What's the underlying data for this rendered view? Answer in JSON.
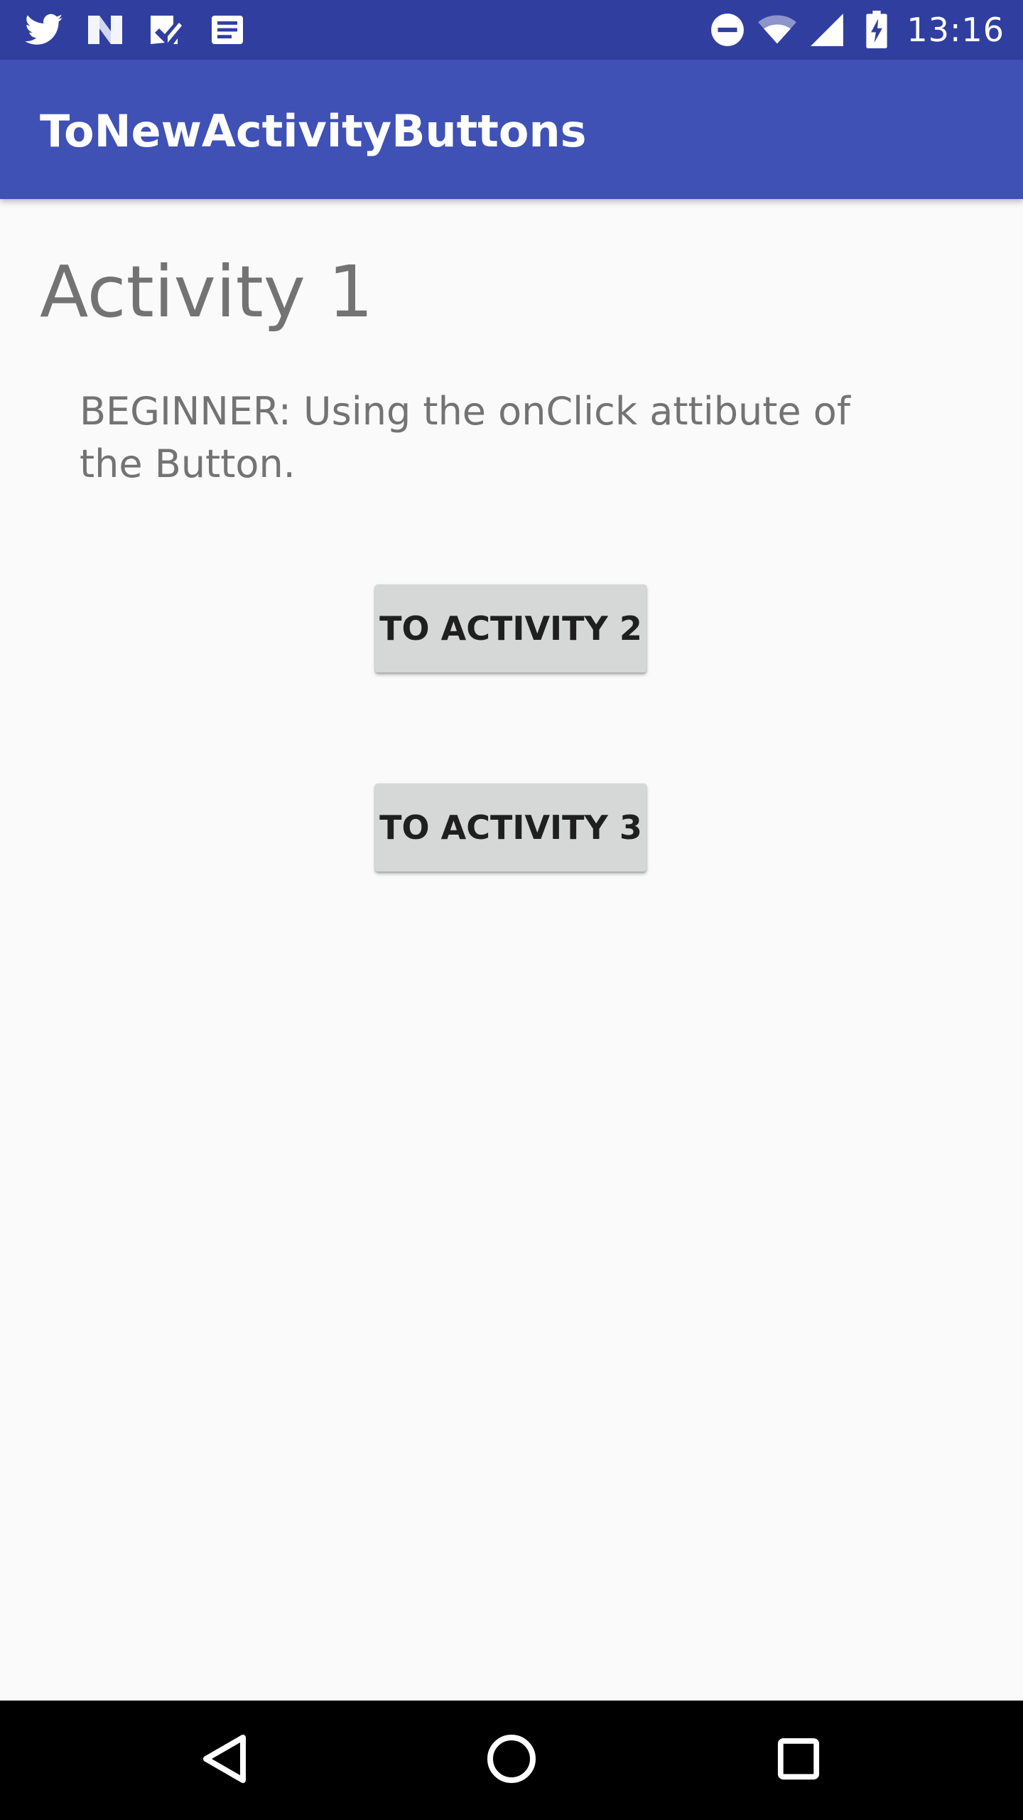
{
  "status_bar": {
    "time": "13:16",
    "background": "#303F9F",
    "left_icons": [
      "twitter-icon",
      "news-icon",
      "checklist-icon",
      "message-icon"
    ],
    "right_icons": [
      "do-not-disturb-icon",
      "wifi-icon",
      "cellular-signal-icon",
      "battery-charging-icon"
    ]
  },
  "app_bar": {
    "title": "ToNewActivityButtons",
    "background": "#3F51B5"
  },
  "content": {
    "heading": "Activity 1",
    "description": "BEGINNER: Using the onClick attibute of the Button.",
    "text_color": "#737373"
  },
  "buttons": {
    "activity2_label": "TO ACTIVITY 2",
    "activity3_label": "TO ACTIVITY 3",
    "background": "#D6D7D7"
  },
  "nav_bar": {
    "items": [
      "back-icon",
      "home-icon",
      "recent-apps-icon"
    ]
  }
}
